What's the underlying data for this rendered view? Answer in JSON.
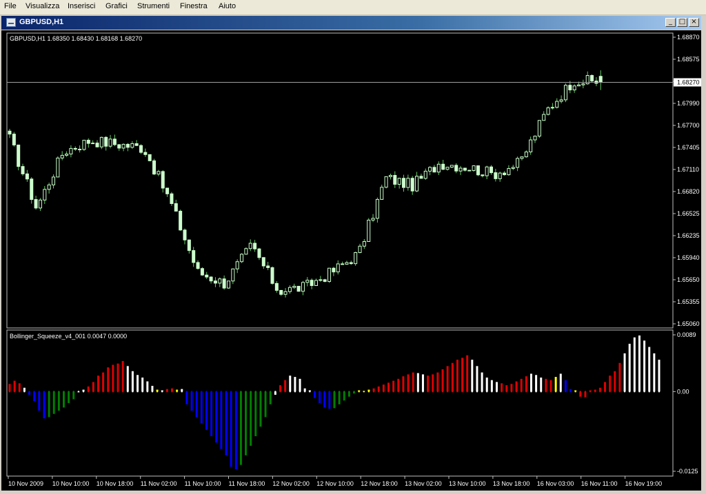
{
  "menu": [
    "File",
    "Visualizza",
    "Inserisci",
    "Grafici",
    "Strumenti",
    "Finestra",
    "Aiuto"
  ],
  "window": {
    "title": "GBPUSD,H1"
  },
  "main_chart": {
    "info": "GBPUSD,H1  1.68350 1.68430 1.68168 1.68270",
    "price_labels": [
      "1.68870",
      "1.68575",
      "1.68270",
      "1.67990",
      "1.67700",
      "1.67405",
      "1.67110",
      "1.66820",
      "1.66525",
      "1.66235",
      "1.65940",
      "1.65650",
      "1.65355",
      "1.65060"
    ],
    "current_price": "1.68270"
  },
  "indicator": {
    "info": "Bollinger_Squeeze_v4_001 0.0047 0.0000",
    "labels": [
      "0.0089",
      "0.00",
      "-0.0125"
    ]
  },
  "time_labels": [
    "10 Nov 2009",
    "10 Nov 10:00",
    "10 Nov 18:00",
    "11 Nov 02:00",
    "11 Nov 10:00",
    "11 Nov 18:00",
    "12 Nov 02:00",
    "12 Nov 10:00",
    "12 Nov 18:00",
    "13 Nov 02:00",
    "13 Nov 10:00",
    "13 Nov 18:00",
    "16 Nov 03:00",
    "16 Nov 11:00",
    "16 Nov 19:00"
  ],
  "colors": {
    "bg": "#000000",
    "candle": "#ccffcc",
    "wick": "#66cc66",
    "red": "#e00000",
    "white": "#ffffff",
    "blue": "#0000ff",
    "green": "#008000",
    "yellow": "#ffff00"
  },
  "chart_data": [
    {
      "type": "candlestick",
      "title": "GBPUSD,H1",
      "ylim": [
        1.6506,
        1.6887
      ],
      "x": [
        "10 Nov 2009",
        "10 Nov 10:00",
        "10 Nov 18:00",
        "11 Nov 02:00",
        "11 Nov 10:00",
        "11 Nov 18:00",
        "12 Nov 02:00",
        "12 Nov 10:00",
        "12 Nov 18:00",
        "13 Nov 02:00",
        "13 Nov 10:00",
        "13 Nov 18:00",
        "16 Nov 03:00",
        "16 Nov 11:00",
        "16 Nov 19:00"
      ],
      "close_keypoints": [
        1.6752,
        1.666,
        1.6735,
        1.675,
        1.6745,
        1.674,
        1.6667,
        1.6575,
        1.656,
        1.661,
        1.655,
        1.6555,
        1.6575,
        1.66,
        1.67,
        1.669,
        1.672,
        1.6715,
        1.6705,
        1.672,
        1.679,
        1.683,
        1.6827
      ],
      "last": {
        "open": 1.6835,
        "high": 1.6843,
        "low": 1.68168,
        "close": 1.6827
      }
    },
    {
      "type": "bar",
      "title": "Bollinger_Squeeze_v4_001",
      "ylim": [
        -0.0125,
        0.0089
      ],
      "values": [
        0.0012,
        0.0017,
        0.0013,
        0.0006,
        -0.0005,
        -0.0015,
        -0.003,
        -0.0042,
        -0.004,
        -0.0035,
        -0.003,
        -0.0025,
        -0.0018,
        -0.0012,
        0.0,
        0.0003,
        0.0008,
        0.0015,
        0.0025,
        0.003,
        0.0038,
        0.0042,
        0.0044,
        0.0048,
        0.004,
        0.0032,
        0.0026,
        0.0022,
        0.0016,
        0.0009,
        0.0003,
        0.0002,
        0.0004,
        0.0005,
        0.0003,
        0.0004,
        -0.002,
        -0.003,
        -0.004,
        -0.005,
        -0.006,
        -0.007,
        -0.008,
        -0.009,
        -0.01,
        -0.0118,
        -0.0122,
        -0.0115,
        -0.01,
        -0.0085,
        -0.007,
        -0.0055,
        -0.004,
        -0.002,
        -0.0005,
        0.001,
        0.0018,
        0.0025,
        0.0023,
        0.002,
        0.0005,
        0.0002,
        -0.001,
        -0.0018,
        -0.0025,
        -0.0027,
        -0.0026,
        -0.002,
        -0.0014,
        -0.0008,
        -0.0003,
        0.0002,
        0.0001,
        0.0003,
        0.0005,
        0.0008,
        0.0011,
        0.0014,
        0.0017,
        0.002,
        0.0024,
        0.0027,
        0.003,
        0.0029,
        0.0027,
        0.0025,
        0.0027,
        0.003,
        0.0035,
        0.004,
        0.0045,
        0.005,
        0.0053,
        0.0057,
        0.005,
        0.004,
        0.003,
        0.0022,
        0.0018,
        0.0015,
        0.0013,
        0.001,
        0.0012,
        0.0016,
        0.002,
        0.0024,
        0.0028,
        0.0026,
        0.0022,
        0.002,
        0.0018,
        0.0023,
        0.0028,
        0.0018,
        0.0004,
        0.0002,
        -0.0008,
        -0.0009,
        0.0002,
        0.0003,
        0.0006,
        0.0015,
        0.0025,
        0.0032,
        0.0045,
        0.006,
        0.0075,
        0.0085,
        0.0088,
        0.008,
        0.007,
        0.006,
        0.005
      ],
      "colors": [
        "red",
        "red",
        "red",
        "white",
        "blue",
        "blue",
        "blue",
        "blue",
        "green",
        "green",
        "green",
        "green",
        "green",
        "green",
        "white",
        "white",
        "red",
        "red",
        "red",
        "red",
        "red",
        "red",
        "red",
        "red",
        "white",
        "white",
        "white",
        "white",
        "white",
        "white",
        "yellow",
        "white",
        "red",
        "red",
        "yellow",
        "white",
        "blue",
        "blue",
        "blue",
        "blue",
        "blue",
        "blue",
        "blue",
        "blue",
        "blue",
        "blue",
        "blue",
        "green",
        "green",
        "green",
        "green",
        "green",
        "green",
        "green",
        "white",
        "red",
        "red",
        "white",
        "white",
        "white",
        "white",
        "white",
        "blue",
        "blue",
        "blue",
        "blue",
        "green",
        "green",
        "green",
        "green",
        "green",
        "yellow",
        "yellow",
        "yellow",
        "red",
        "red",
        "red",
        "red",
        "red",
        "red",
        "red",
        "red",
        "red",
        "white",
        "white",
        "red",
        "red",
        "red",
        "red",
        "red",
        "red",
        "red",
        "red",
        "red",
        "white",
        "white",
        "white",
        "white",
        "white",
        "white",
        "red",
        "red",
        "red",
        "red",
        "red",
        "red",
        "white",
        "white",
        "white",
        "red",
        "red",
        "yellow",
        "white",
        "blue",
        "blue",
        "yellow",
        "red",
        "red",
        "red",
        "red",
        "red",
        "red",
        "red",
        "red",
        "red",
        "white",
        "white",
        "white",
        "white",
        "white"
      ]
    }
  ]
}
